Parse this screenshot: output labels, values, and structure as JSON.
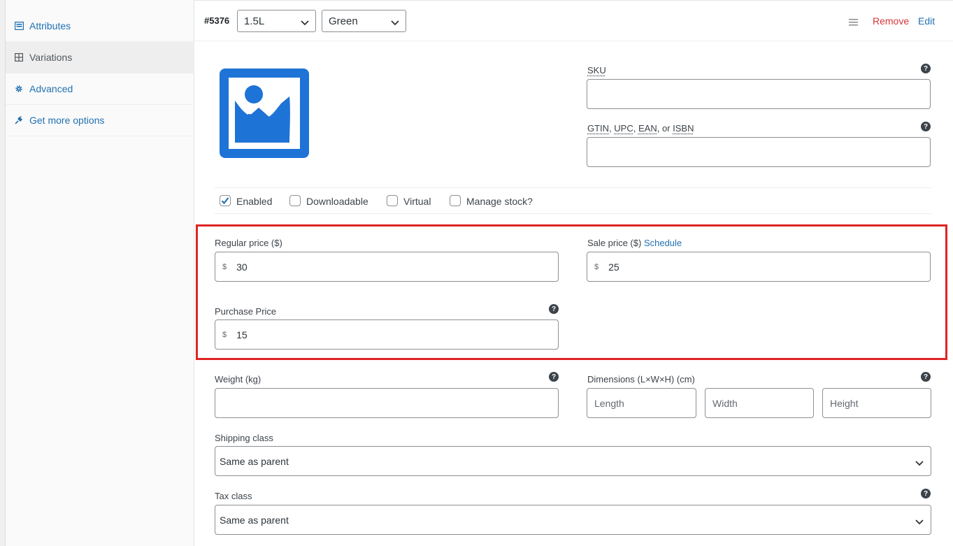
{
  "sidebar": {
    "items": [
      {
        "label": "Attributes",
        "icon": "attributes-icon",
        "active": false
      },
      {
        "label": "Variations",
        "icon": "grid-icon",
        "active": true
      },
      {
        "label": "Advanced",
        "icon": "gear-icon",
        "active": false
      },
      {
        "label": "Get more options",
        "icon": "plugin-icon",
        "active": false
      }
    ]
  },
  "variation": {
    "id": "#5376",
    "attribute1": "1.5L",
    "attribute2": "Green",
    "remove_label": "Remove",
    "edit_label": "Edit"
  },
  "fields": {
    "sku_label": "SKU",
    "sku_value": "",
    "gtin_parts": [
      "GTIN",
      ", ",
      "UPC",
      ", ",
      "EAN",
      ", or ",
      "ISBN"
    ],
    "gtin_value": "",
    "checkboxes": [
      {
        "label": "Enabled",
        "checked": true
      },
      {
        "label": "Downloadable",
        "checked": false
      },
      {
        "label": "Virtual",
        "checked": false
      },
      {
        "label": "Manage stock?",
        "checked": false
      }
    ],
    "regular_price_label": "Regular price ($)",
    "regular_price_value": "30",
    "sale_price_label": "Sale price ($)",
    "schedule_label": "Schedule",
    "sale_price_value": "25",
    "purchase_price_label": "Purchase Price",
    "purchase_price_value": "15",
    "currency_symbol": "$",
    "weight_label": "Weight (kg)",
    "weight_value": "",
    "dimensions_label": "Dimensions (L×W×H) (cm)",
    "length_placeholder": "Length",
    "width_placeholder": "Width",
    "height_placeholder": "Height",
    "shipping_class_label": "Shipping class",
    "shipping_class_value": "Same as parent",
    "tax_class_label": "Tax class",
    "tax_class_value": "Same as parent",
    "help_glyph": "?"
  },
  "colors": {
    "link": "#2271b1",
    "remove": "#d63638",
    "highlight": "#e02424",
    "thumb": "#1e73d6"
  }
}
